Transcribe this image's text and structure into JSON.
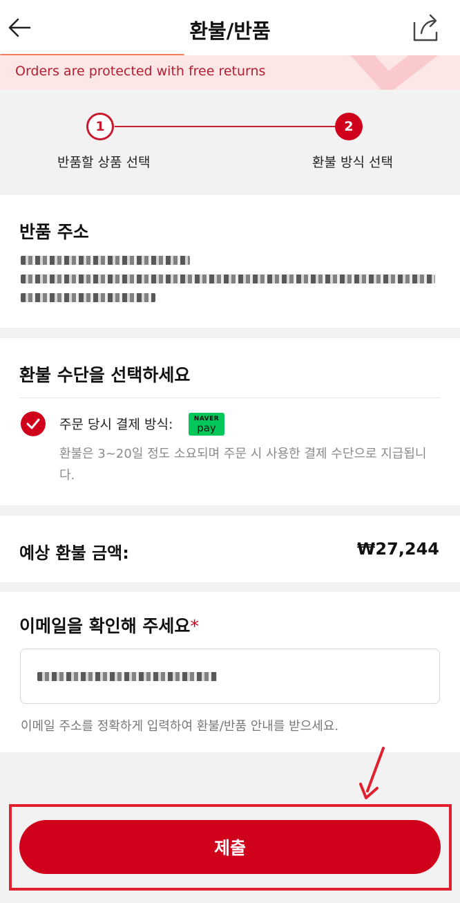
{
  "header": {
    "title": "환불/반품"
  },
  "banner": {
    "text": "Orders are protected with free returns"
  },
  "steps": [
    {
      "number": "1",
      "label": "반품할 상품 선택"
    },
    {
      "number": "2",
      "label": "환불 방식 선택"
    }
  ],
  "return_address": {
    "title": "반품 주소"
  },
  "refund_method": {
    "title": "환불 수단을 선택하세요",
    "option_label": "주문 당시 결제 방식:",
    "pay_logo_top": "NAVER",
    "pay_logo_bottom": "pay",
    "note": "환불은 3~20일 정도 소요되며 주문 시 사용한 결제 수단으로 지급됩니다."
  },
  "amount": {
    "label": "예상 환불 금액:",
    "value": "₩27,244"
  },
  "email": {
    "title": "이메일을 확인해 주세요",
    "required_mark": "*",
    "help": "이메일 주소를 정확하게 입력하여 환불/반품 안내를 받으세요."
  },
  "submit": {
    "label": "제출"
  },
  "icons": [
    "back-arrow-icon",
    "share-icon",
    "check-icon",
    "annotation-arrow-icon"
  ],
  "colors": {
    "accent": "#d0021b",
    "banner_bg": "#fde6e6",
    "naver_green": "#03c75a",
    "highlight_frame": "#e0202e"
  }
}
